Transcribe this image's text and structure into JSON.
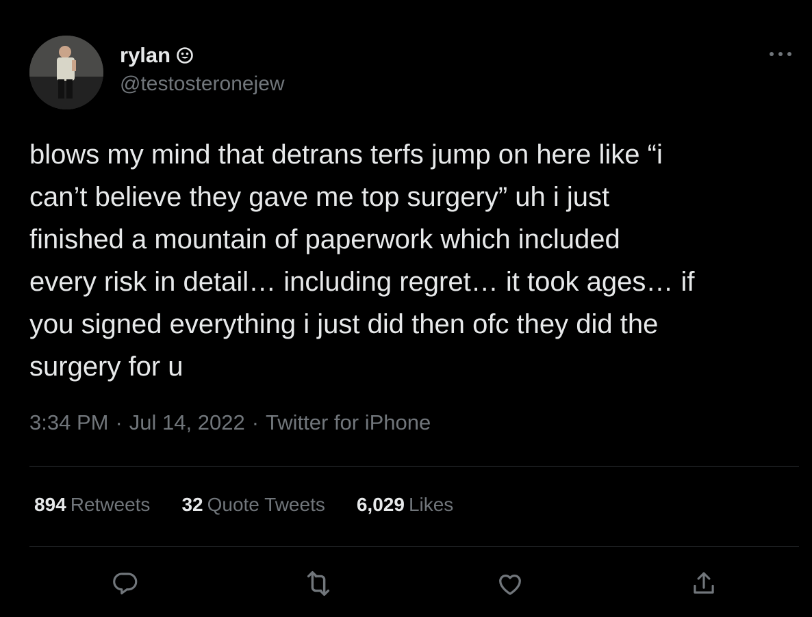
{
  "author": {
    "display_name": "rylan",
    "name_emoji": "smiley-face-icon",
    "handle": "@testosteronejew"
  },
  "tweet": {
    "text": "blows my mind that detrans terfs jump on here like “i\ncan’t believe they gave me top surgery” uh i just\nfinished a mountain of paperwork which included\nevery risk in detail… including regret… it took ages… if\nyou signed everything i just did then ofc they did the\nsurgery for u"
  },
  "meta": {
    "time": "3:34 PM",
    "separator": "·",
    "date": "Jul 14, 2022",
    "source": "Twitter for iPhone"
  },
  "stats": {
    "retweets_count": "894",
    "retweets_label": "Retweets",
    "quotes_count": "32",
    "quotes_label": "Quote Tweets",
    "likes_count": "6,029",
    "likes_label": "Likes"
  },
  "actions": [
    "reply-icon",
    "retweet-icon",
    "like-icon",
    "share-icon"
  ],
  "colors": {
    "background": "#000000",
    "text_primary": "#e7e9ea",
    "text_secondary": "#71767b",
    "divider": "#2f3336"
  }
}
